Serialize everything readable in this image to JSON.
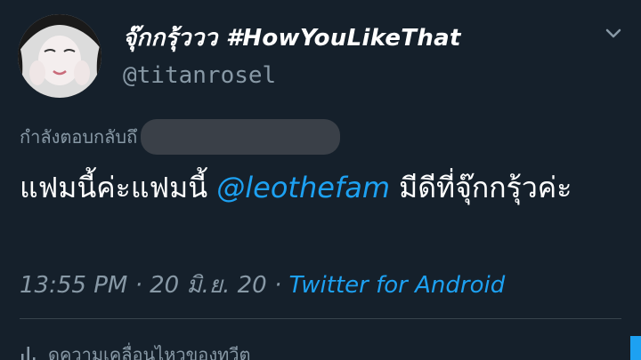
{
  "tweet": {
    "display_name": "จุ๊กกรุ้ววว #HowYouLikeThat",
    "handle": "@titanrosel",
    "reply_prefix": "กำลังตอบกลับถึ",
    "text_parts": {
      "before": "แฟมนี้ค่ะแฟมนี้ ",
      "mention": "@leothefam",
      "after": " มีดีที่จุ๊กกรุ้วค่ะ"
    },
    "time": "13:55 PM",
    "separator": " · ",
    "date": "20 มิ.ย. 20",
    "source": "Twitter for Android",
    "activity_label": "ดูความเคลื่อนไหวของทวีต"
  },
  "icons": {
    "menu": "chevron-down-icon",
    "activity": "bar-chart-icon",
    "avatar": "avatar"
  },
  "colors": {
    "background": "#15202b",
    "primary_text": "#ffffff",
    "secondary_text": "#8899a6",
    "accent": "#1da1f2",
    "divider": "#38444d"
  }
}
